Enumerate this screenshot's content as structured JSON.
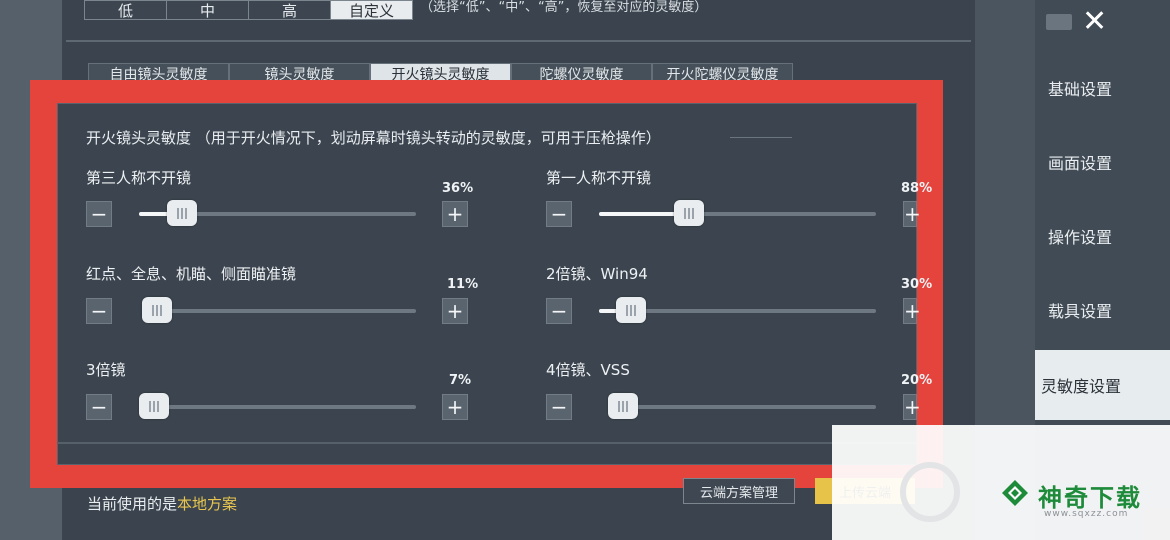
{
  "presets": {
    "buttons": [
      "低",
      "中",
      "高",
      "自定义"
    ],
    "active_index": 3,
    "hint": "（选择“低”、“中”、“高”，恢复至对应的灵敏度）"
  },
  "tabs": {
    "items": [
      "自由镜头灵敏度",
      "镜头灵敏度",
      "开火镜头灵敏度",
      "陀螺仪灵敏度",
      "开火陀螺仪灵敏度"
    ],
    "active_index": 2
  },
  "section": {
    "title": "开火镜头灵敏度 （用于开火情况下，划动屏幕时镜头转动的灵敏度，可用于压枪操作）"
  },
  "sliders": [
    {
      "label": "第三人称不开镜",
      "value_text": "36%",
      "level": 0.12
    },
    {
      "label": "第一人称不开镜",
      "value_text": "88%",
      "level": 0.29
    },
    {
      "label": "红点、全息、机瞄、侧面瞄准镜",
      "value_text": "11%",
      "level": 0.0
    },
    {
      "label": "2倍镜、Win94",
      "value_text": "30%",
      "level": 0.08
    },
    {
      "label": "3倍镜",
      "value_text": "7%",
      "level": 0.0
    },
    {
      "label": "4倍镜、VSS",
      "value_text": "20%",
      "level": 0.0
    }
  ],
  "controls": {
    "minus": "−",
    "plus": "+"
  },
  "footer": {
    "prefix": "当前使用的是",
    "scheme": "本地方案",
    "cloud_button": "云端方案管理",
    "upload_button": "上传云端"
  },
  "sidebar": {
    "items": [
      "基础设置",
      "画面设置",
      "操作设置",
      "载具设置",
      "灵敏度设置"
    ],
    "active_index": 4,
    "close": "✕"
  },
  "watermark": {
    "brand": "神奇下载",
    "url": "www.sqxzz.com"
  },
  "colors": {
    "highlight_frame": "#e5443d",
    "accent_yellow": "#e8c64f",
    "watermark_green": "#1d8b3a"
  }
}
